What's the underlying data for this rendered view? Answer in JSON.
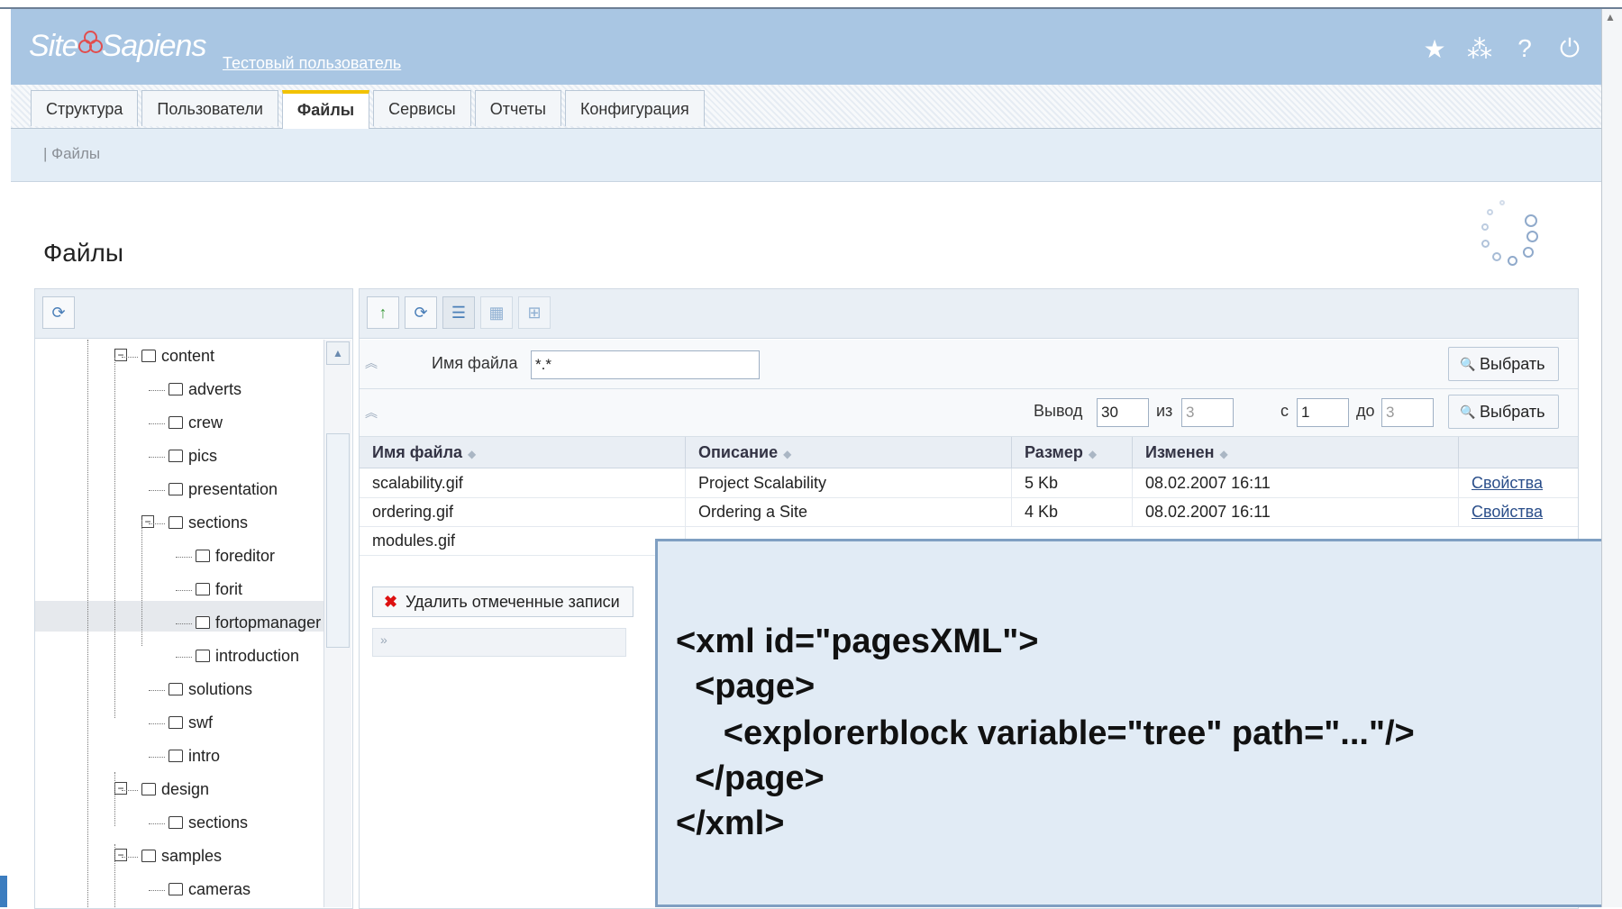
{
  "header": {
    "logo": "SiteSapiens",
    "user_link": "Тестовый пользователь",
    "icons": [
      "star-icon",
      "share-icon",
      "help-icon",
      "power-icon"
    ]
  },
  "tabs": [
    "Структура",
    "Пользователи",
    "Файлы",
    "Сервисы",
    "Отчеты",
    "Конфигурация"
  ],
  "active_tab": "Файлы",
  "breadcrumb": "| Файлы",
  "page_title": "Файлы",
  "tree": {
    "nodes": [
      {
        "label": "content",
        "level": 0,
        "expanded": true
      },
      {
        "label": "adverts",
        "level": 1
      },
      {
        "label": "crew",
        "level": 1
      },
      {
        "label": "pics",
        "level": 1
      },
      {
        "label": "presentation",
        "level": 1
      },
      {
        "label": "sections",
        "level": 1,
        "expanded": true
      },
      {
        "label": "foreditor",
        "level": 2
      },
      {
        "label": "forit",
        "level": 2
      },
      {
        "label": "fortopmanager",
        "level": 2,
        "selected": true
      },
      {
        "label": "introduction",
        "level": 2
      },
      {
        "label": "solutions",
        "level": 1
      },
      {
        "label": "swf",
        "level": 1
      },
      {
        "label": "intro",
        "level": 1
      },
      {
        "label": "design",
        "level": 0,
        "expanded": true
      },
      {
        "label": "sections",
        "level": 1
      },
      {
        "label": "samples",
        "level": 0,
        "expanded": true
      },
      {
        "label": "cameras",
        "level": 1
      }
    ]
  },
  "filter": {
    "filename_label": "Имя файла",
    "filename_value": "*.*",
    "select_label": "Выбрать",
    "output_label": "Вывод",
    "output_value": "30",
    "of_label": "из",
    "of_value": "3",
    "from_label": "с",
    "from_value": "1",
    "to_label": "до",
    "to_value": "3"
  },
  "table": {
    "columns": [
      "Имя файла",
      "Описание",
      "Размер",
      "Изменен"
    ],
    "rows": [
      {
        "name": "scalability.gif",
        "desc": "Project Scalability",
        "size": "5 Kb",
        "modified": "08.02.2007 16:11",
        "action": "Свойства"
      },
      {
        "name": "ordering.gif",
        "desc": "Ordering a Site",
        "size": "4 Kb",
        "modified": "08.02.2007 16:11",
        "action": "Свойства"
      },
      {
        "name": "modules.gif",
        "desc": "",
        "size": "",
        "modified": "",
        "action": ""
      }
    ],
    "delete_label": "Удалить отмеченные записи"
  },
  "overlay_code": {
    "line1": "<xml id=\"pagesXML\">",
    "line2": "  <page>",
    "line3": "     <explorerblock variable=\"tree\" path=\"...\"/>",
    "line4": "  </page>",
    "line5": "</xml>"
  },
  "colors": {
    "header": "#a9c6e3",
    "active_tab_accent": "#f2c200",
    "overlay_bg": "#e1ebf5",
    "link": "#2a4e8a"
  }
}
